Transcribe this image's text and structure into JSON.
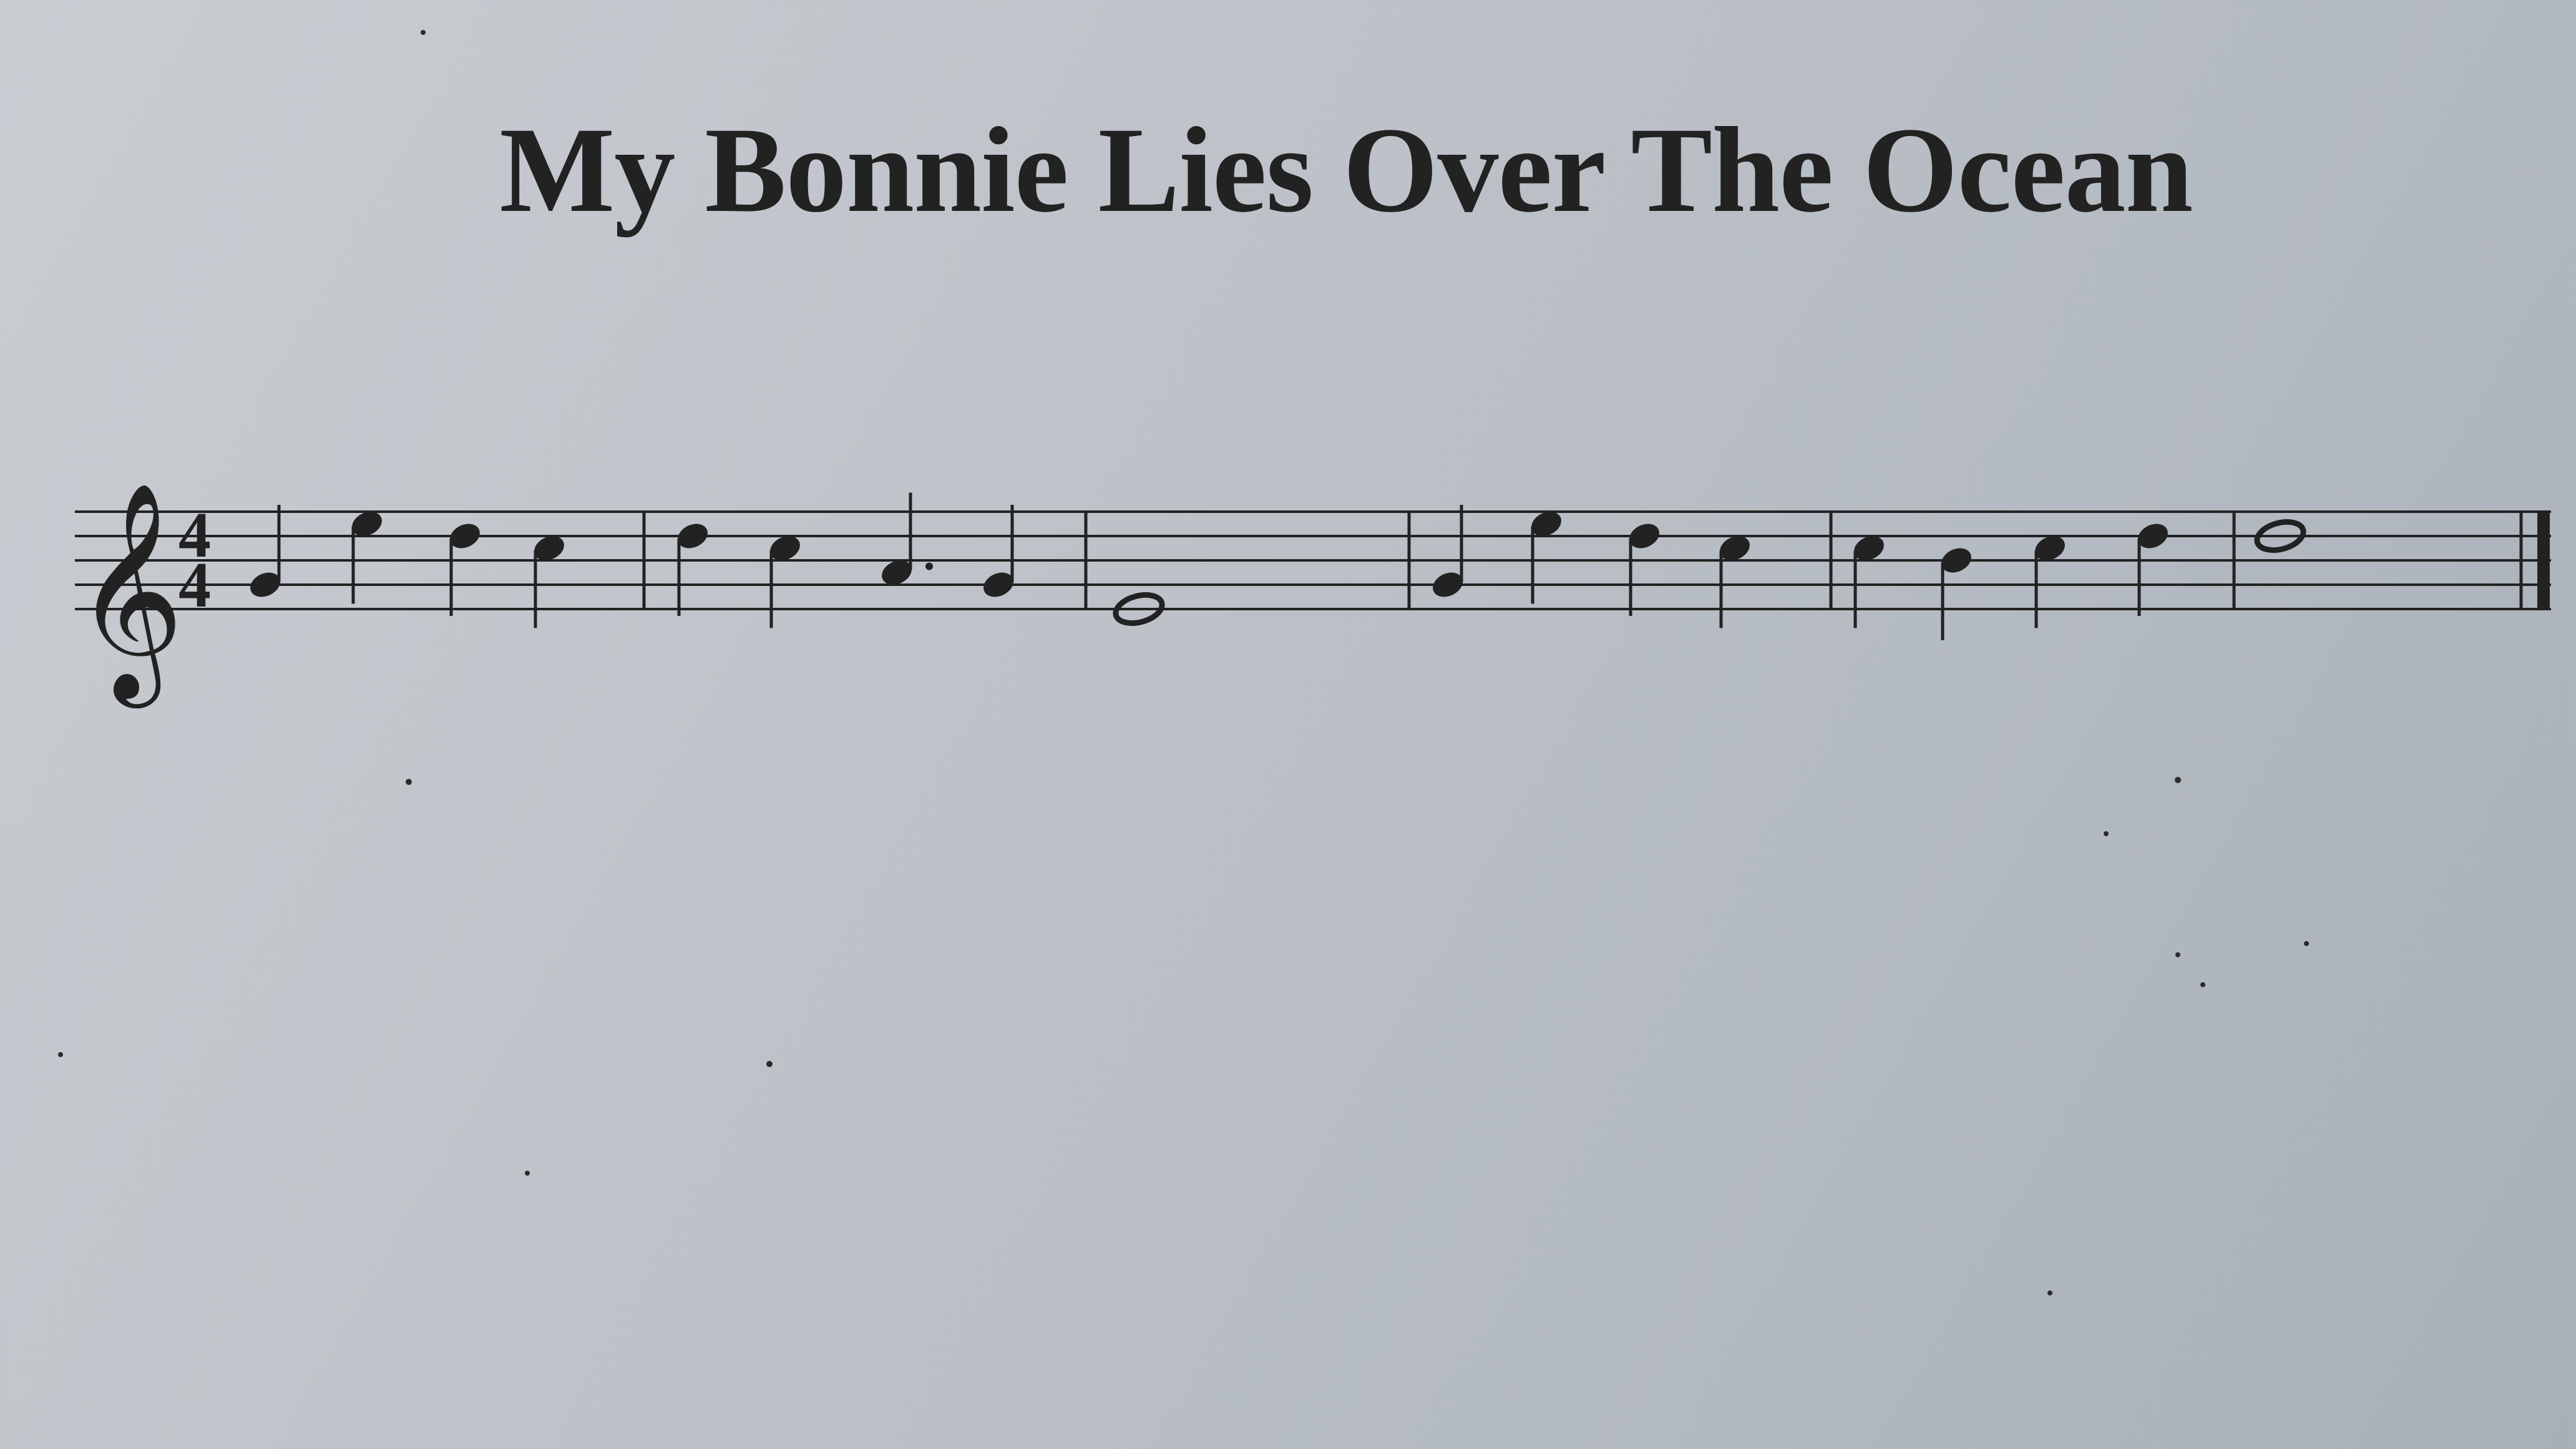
{
  "title": "My Bonnie Lies Over The Ocean",
  "time_signature": {
    "top": "4",
    "bottom": "4"
  },
  "colors": {
    "ink": "#222222",
    "paper": "#bfc4ca"
  },
  "notes": [
    {
      "measure": 1,
      "pitch": "G4",
      "dur": "quarter"
    },
    {
      "measure": 1,
      "pitch": "E5",
      "dur": "quarter"
    },
    {
      "measure": 1,
      "pitch": "D5",
      "dur": "quarter"
    },
    {
      "measure": 1,
      "pitch": "C5",
      "dur": "quarter"
    },
    {
      "measure": 2,
      "pitch": "D5",
      "dur": "quarter"
    },
    {
      "measure": 2,
      "pitch": "C5",
      "dur": "quarter"
    },
    {
      "measure": 2,
      "pitch": "A4",
      "dur": "dotted-quarter"
    },
    {
      "measure": 2,
      "pitch": "G4",
      "dur": "eighth-or-quarter"
    },
    {
      "measure": 3,
      "pitch": "E4",
      "dur": "whole"
    },
    {
      "measure": 4,
      "pitch": "G4",
      "dur": "quarter"
    },
    {
      "measure": 4,
      "pitch": "E5",
      "dur": "quarter"
    },
    {
      "measure": 4,
      "pitch": "D5",
      "dur": "quarter"
    },
    {
      "measure": 4,
      "pitch": "C5",
      "dur": "quarter"
    },
    {
      "measure": 5,
      "pitch": "C5",
      "dur": "quarter"
    },
    {
      "measure": 5,
      "pitch": "B4",
      "dur": "quarter"
    },
    {
      "measure": 5,
      "pitch": "C5",
      "dur": "quarter"
    },
    {
      "measure": 5,
      "pitch": "D5",
      "dur": "quarter"
    },
    {
      "measure": 6,
      "pitch": "D5",
      "dur": "whole"
    }
  ]
}
